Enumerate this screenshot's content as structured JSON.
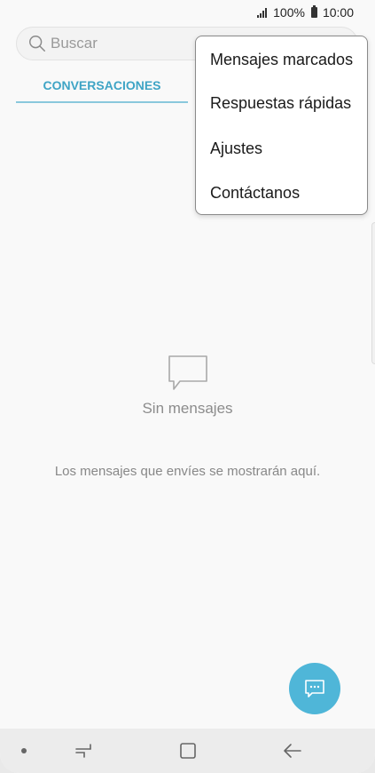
{
  "status_bar": {
    "battery": "100%",
    "time": "10:00"
  },
  "search": {
    "placeholder": "Buscar"
  },
  "tabs": [
    {
      "label": "CONVERSACIONES",
      "active": true
    }
  ],
  "menu": {
    "items": [
      {
        "label": "Mensajes marcados"
      },
      {
        "label": "Respuestas rápidas"
      },
      {
        "label": "Ajustes"
      },
      {
        "label": "Contáctanos"
      }
    ]
  },
  "empty_state": {
    "title": "Sin mensajes",
    "description": "Los mensajes que envíes se mostrarán aquí."
  },
  "fab": {
    "icon": "new-message-icon"
  },
  "nav_bar": {
    "icons": [
      "dot-icon",
      "recent-apps-icon",
      "home-icon",
      "back-icon"
    ]
  },
  "colors": {
    "accent": "#3ea4c5",
    "fab": "#4fb6d8",
    "tab_underline": "#8ac8dc"
  }
}
